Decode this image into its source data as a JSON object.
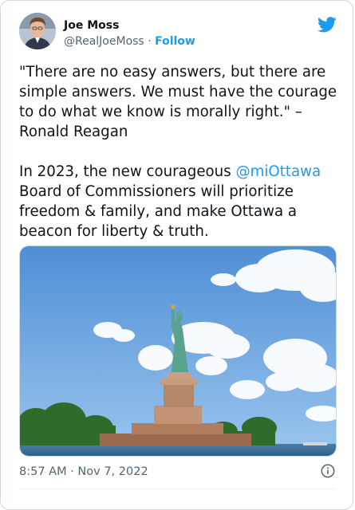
{
  "author": {
    "name": "Joe Moss",
    "handle": "@RealJoeMoss",
    "separator": "·",
    "follow_label": "Follow"
  },
  "tweet": {
    "quote": "\"There are no easy answers, but there are simple answers. We must have the courage to do what we know is morally right.\" –\nRonald Reagan",
    "line2_prefix": "In 2023, the new courageous ",
    "mention": "@miOttawa",
    "line2_suffix": "\nBoard of Commissioners will prioritize freedom & family, and make Ottawa a beacon for liberty & truth."
  },
  "timestamp": "8:57 AM · Nov 7, 2022",
  "icons": {
    "logo": "twitter-bird-icon",
    "info": "info-icon"
  },
  "colors": {
    "accent": "#1d9bf0",
    "text": "#0f1419",
    "secondary": "#536471"
  }
}
